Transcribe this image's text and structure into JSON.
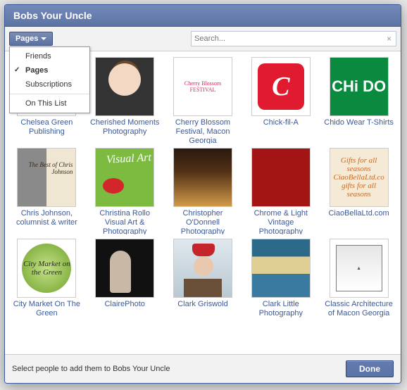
{
  "dialog": {
    "title": "Bobs Your Uncle",
    "footer_hint": "Select people to add them to Bobs Your Uncle",
    "done_label": "Done"
  },
  "filter": {
    "button_label": "Pages",
    "menu": {
      "friends": "Friends",
      "pages": "Pages",
      "subscriptions": "Subscriptions",
      "on_this_list": "On This List"
    }
  },
  "search": {
    "placeholder": "Search..."
  },
  "grid": {
    "items": [
      {
        "label": "Chelsea Green Publishing"
      },
      {
        "label": "Cherished Moments Photography"
      },
      {
        "label": "Cherry Blossom Festival, Macon Georgia"
      },
      {
        "label": "Chick-fil-A"
      },
      {
        "label": "Chido Wear T-Shirts"
      },
      {
        "label": "Chris Johnson, columnist & writer"
      },
      {
        "label": "Christina Rollo Visual Art & Photography"
      },
      {
        "label": "Christopher O'Donnell Photography"
      },
      {
        "label": "Chrome & Light Vintage Photography"
      },
      {
        "label": "CiaoBellaLtd.com"
      },
      {
        "label": "City Market On The Green"
      },
      {
        "label": "ClairePhoto"
      },
      {
        "label": "Clark Griswold"
      },
      {
        "label": "Clark Little Photography"
      },
      {
        "label": "Classic Architecture of Macon Georgia"
      }
    ]
  },
  "thumb_text": {
    "cherry": "Cherry Blossom FESTIVAL",
    "chick": "C",
    "chido": "CHi DO",
    "chris": "The Best of Chris Johnson",
    "christina": "Visual Art",
    "ciao": "Gifts for all seasons CiaoBellaLtd.co gifts for all seasons",
    "city": "City Market on the Green"
  }
}
